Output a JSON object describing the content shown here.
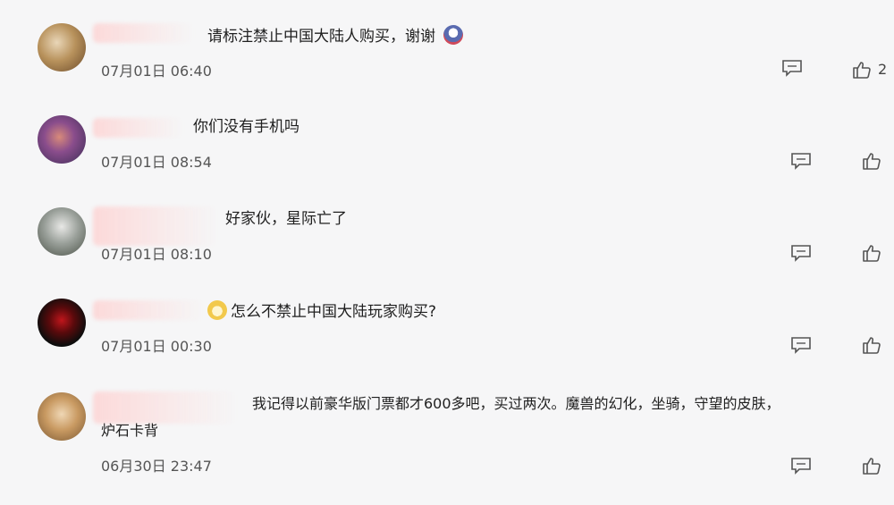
{
  "comments": [
    {
      "text": "请标注禁止中国大陆人购买，谢谢",
      "time": "07月01日 06:40",
      "likes": "2",
      "emoji": "laughing-face"
    },
    {
      "text": "你们没有手机吗",
      "time": "07月01日 08:54"
    },
    {
      "text": "好家伙，星际亡了",
      "time": "07月01日 08:10"
    },
    {
      "text": "怎么不禁止中国大陆玩家购买?",
      "time": "07月01日 00:30",
      "emoji": "cat-face"
    },
    {
      "text_line1": "我记得以前豪华版门票都才600多吧，买过两次。魔兽的幻化，坐骑，守望的皮肤，",
      "text_line2": "炉石卡背",
      "time": "06月30日 23:47"
    }
  ],
  "icons": {
    "reply": "reply-icon",
    "like": "thumbs-up-icon"
  },
  "colors": {
    "background": "#f6f6f7",
    "name_blur": "#fcd6d6",
    "icon": "#555555"
  }
}
